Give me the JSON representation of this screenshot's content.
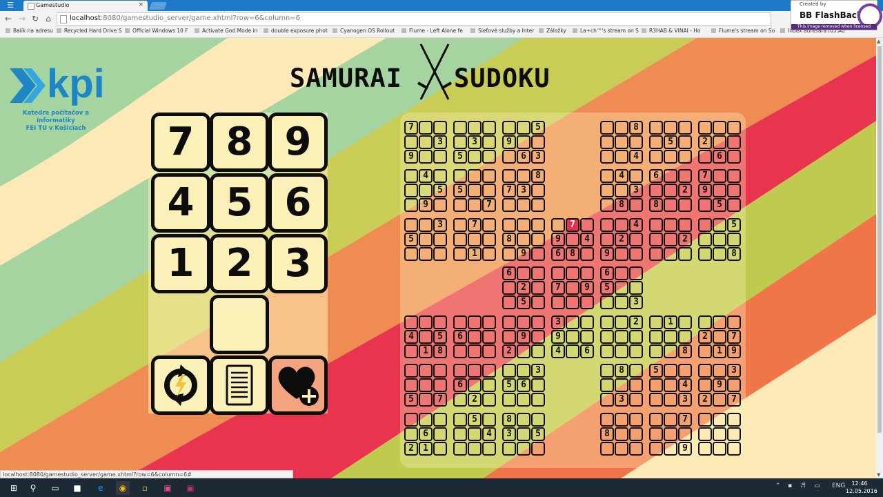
{
  "browser": {
    "tab_title": "Gamestudio",
    "url_host": "localhost",
    "url_path": ":8080/gamestudio_server/game.xhtml?row=6&column=6",
    "bookmarks": [
      "Balík na adresu",
      "Recycled Hard Drive S",
      "Official Windows 10 F",
      "Activate God Mode in",
      "double exposure phot",
      "Cyanogen OS Rollout",
      "Flume - Left Alone fe",
      "Sieťové služby a Inter",
      "Záložky",
      "La+ch™'s stream on S",
      "R3HAB & VINAI - Ho",
      "Flume's stream on So",
      "Index adresára /05.Ad"
    ],
    "status_url": "localhost:8080/gamestudio_server/game.xhtml?row=6&column=6#"
  },
  "watermark": {
    "created_by": "Created by",
    "product": "BB FlashBack",
    "notice": "This image removed when licensed"
  },
  "logo": {
    "text": "kpi",
    "dept_line1": "Katedra počítačov a informatiky",
    "dept_line2": "FEI TU v Košiciach"
  },
  "title": {
    "left": "SAMURAI",
    "right": "SUDOKU"
  },
  "keypad": {
    "digits": [
      "7",
      "8",
      "9",
      "4",
      "5",
      "6",
      "1",
      "2",
      "3"
    ],
    "actions": [
      {
        "name": "refresh",
        "icon": "refresh-icon"
      },
      {
        "name": "rules",
        "icon": "document-icon"
      },
      {
        "name": "hint",
        "icon": "heart-plus-icon"
      }
    ]
  },
  "board": {
    "selected": "7",
    "cells": [
      "7",
      "",
      "",
      "",
      "",
      "3",
      "9",
      "",
      "",
      "",
      "",
      "",
      "",
      "3",
      "",
      "5",
      "",
      "",
      "",
      "",
      "5",
      "9",
      "",
      "",
      "",
      "6",
      "3",
      "",
      "",
      "8",
      "",
      "",
      "",
      "",
      "",
      "4",
      "",
      "",
      "",
      "",
      "5",
      "",
      "",
      "",
      "",
      "",
      "",
      "",
      "2",
      "",
      "",
      "",
      "6",
      "",
      "",
      "4",
      "",
      "",
      "",
      "5",
      "",
      "9",
      "",
      "",
      "",
      "",
      "5",
      "",
      "",
      "",
      "",
      "7",
      "",
      "",
      "8",
      "7",
      "3",
      "",
      "",
      "",
      "",
      "",
      "4",
      "",
      "",
      "",
      "3",
      "",
      "8",
      "",
      "6",
      "",
      "",
      "",
      "",
      "2",
      "8",
      "",
      "",
      "7",
      "",
      "",
      "9",
      "",
      "",
      "",
      "5",
      "",
      "",
      "",
      "3",
      "5",
      "",
      "",
      "",
      "",
      "",
      "",
      "7",
      "",
      "",
      "",
      "",
      "",
      "1",
      "",
      "",
      "",
      "",
      "8",
      "",
      "",
      "",
      "9",
      "",
      "",
      "3",
      "",
      "9",
      "",
      "4",
      "6",
      "8",
      "",
      "",
      "",
      "4",
      "",
      "2",
      "",
      "9",
      "",
      "",
      "",
      "",
      "",
      "",
      "",
      "2",
      "",
      "",
      "",
      "",
      "",
      "5",
      "",
      "",
      "",
      "",
      "",
      "8",
      "6",
      "",
      "",
      "",
      "2",
      "",
      "",
      "5",
      "",
      "",
      "",
      "",
      "7",
      "",
      "9",
      "",
      "",
      "",
      "6",
      "",
      "",
      "5",
      "",
      "",
      "",
      "",
      "3",
      "",
      "",
      "",
      "4",
      "",
      "5",
      "",
      "1",
      "8",
      "",
      "",
      "",
      "6",
      "",
      "",
      "",
      "",
      "",
      "",
      "",
      "",
      "",
      "9",
      "",
      "2",
      "",
      "",
      "3",
      "",
      "",
      "9",
      "",
      "",
      "4",
      "",
      "6",
      "",
      "",
      "2",
      "",
      "",
      "",
      "",
      "",
      "",
      "",
      "1",
      "",
      "",
      "",
      "",
      "",
      "",
      "8",
      "",
      "",
      "",
      "2",
      "",
      "7",
      "",
      "1",
      "9",
      "",
      "",
      "",
      "",
      "",
      "",
      "5",
      "",
      "7",
      "",
      "",
      "",
      "6",
      "",
      "",
      "",
      "2",
      "",
      "",
      "",
      "3",
      "5",
      "6",
      "",
      "",
      "",
      "",
      "",
      "8",
      "",
      "",
      "",
      "",
      "",
      "3",
      "",
      "5",
      "",
      "",
      "",
      "",
      "4",
      "",
      "",
      "3",
      "",
      "",
      "3",
      "",
      "9",
      "",
      "2",
      "",
      "7",
      "",
      "",
      "",
      "",
      "6",
      "",
      "2",
      "1",
      "",
      "",
      "5",
      "",
      "",
      "",
      "4",
      "",
      "",
      "",
      "8",
      "",
      "",
      "3",
      "",
      "5",
      "",
      "",
      "",
      "",
      "",
      "",
      "8",
      "",
      "",
      "",
      "",
      "",
      "",
      "",
      "7",
      "",
      "",
      "",
      "",
      "",
      "9",
      ""
    ]
  }
}
